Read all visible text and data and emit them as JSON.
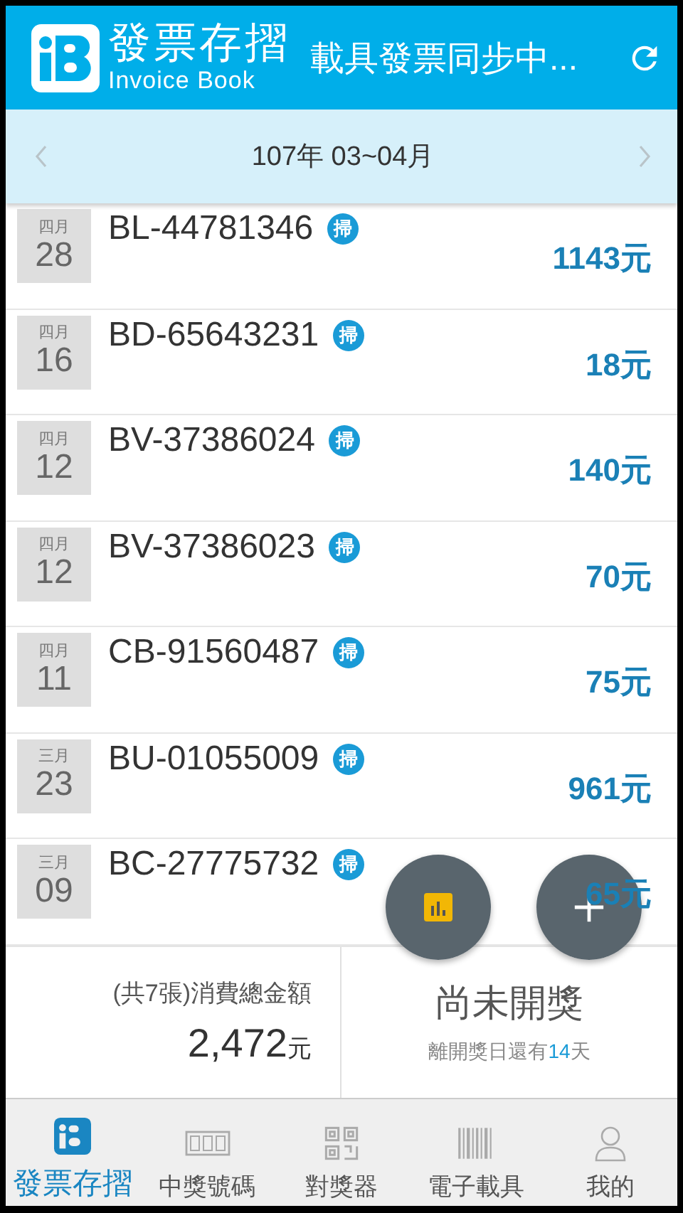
{
  "header": {
    "app_name": "發票存摺",
    "app_subtitle": "Invoice Book",
    "status": "載具發票同步中..."
  },
  "period": {
    "label": "107年 03~04月"
  },
  "invoices": [
    {
      "month": "四月",
      "day": "28",
      "number": "BL-44781346",
      "badge": "掃",
      "amount": "1143元"
    },
    {
      "month": "四月",
      "day": "16",
      "number": "BD-65643231",
      "badge": "掃",
      "amount": "18元"
    },
    {
      "month": "四月",
      "day": "12",
      "number": "BV-37386024",
      "badge": "掃",
      "amount": "140元"
    },
    {
      "month": "四月",
      "day": "12",
      "number": "BV-37386023",
      "badge": "掃",
      "amount": "70元"
    },
    {
      "month": "四月",
      "day": "11",
      "number": "CB-91560487",
      "badge": "掃",
      "amount": "75元"
    },
    {
      "month": "三月",
      "day": "23",
      "number": "BU-01055009",
      "badge": "掃",
      "amount": "961元"
    },
    {
      "month": "三月",
      "day": "09",
      "number": "BC-27775732",
      "badge": "掃",
      "amount": "65元"
    }
  ],
  "summary": {
    "label": "(共7張)消費總金額",
    "total": "2,472",
    "unit": "元",
    "draw_status": "尚未開獎",
    "countdown_before": "離開獎日還有",
    "countdown_days": "14",
    "countdown_after": "天"
  },
  "nav": [
    {
      "kind": "book",
      "label": "發票存摺",
      "selected": true
    },
    {
      "kind": "numbers",
      "label": "中獎號碼",
      "selected": false
    },
    {
      "kind": "qr",
      "label": "對獎器",
      "selected": false
    },
    {
      "kind": "barcode",
      "label": "電子載具",
      "selected": false
    },
    {
      "kind": "person",
      "label": "我的",
      "selected": false
    }
  ]
}
